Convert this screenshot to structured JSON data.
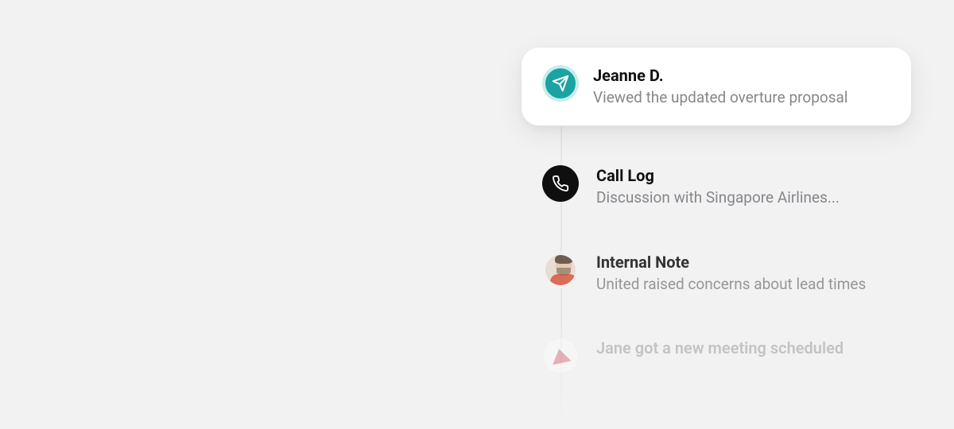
{
  "timeline": {
    "items": [
      {
        "icon": "send-icon",
        "title": "Jeanne D.",
        "subtitle": "Viewed the updated overture proposal"
      },
      {
        "icon": "phone-icon",
        "title": "Call Log",
        "subtitle": "Discussion with Singapore Airlines..."
      },
      {
        "icon": "avatar-person",
        "title": "Internal Note",
        "subtitle": "United raised concerns about lead times"
      },
      {
        "icon": "airline-logo",
        "title": "Jane got a new meeting scheduled",
        "subtitle": ""
      }
    ]
  }
}
